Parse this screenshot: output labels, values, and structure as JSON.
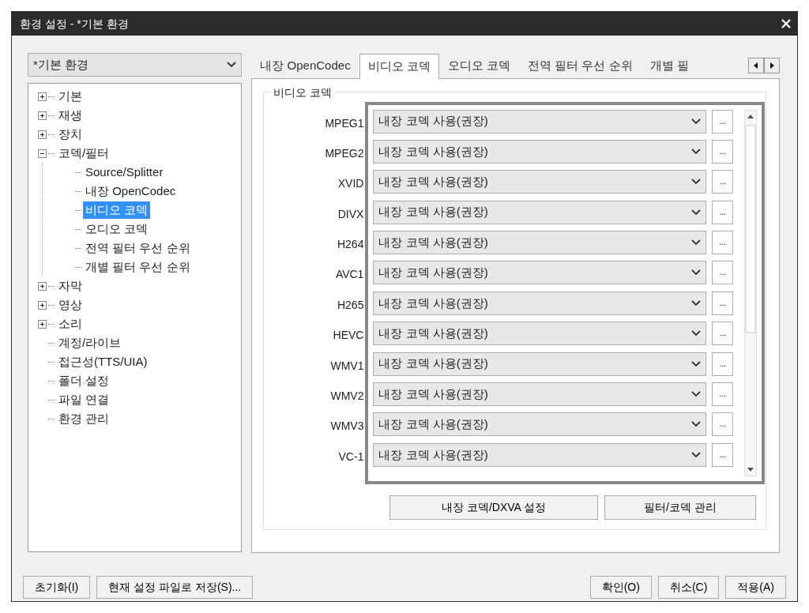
{
  "window": {
    "title": "환경 설정 - *기본 환경"
  },
  "profile": {
    "value": "*기본 환경"
  },
  "tree": [
    {
      "label": "기본",
      "expanded": false,
      "selected": false
    },
    {
      "label": "재생",
      "expanded": false,
      "selected": false
    },
    {
      "label": "장치",
      "expanded": false,
      "selected": false
    },
    {
      "label": "코덱/필터",
      "expanded": true,
      "selected": false,
      "children": [
        {
          "label": "Source/Splitter",
          "selected": false
        },
        {
          "label": "내장 OpenCodec",
          "selected": false
        },
        {
          "label": "비디오 코덱",
          "selected": true
        },
        {
          "label": "오디오 코덱",
          "selected": false
        },
        {
          "label": "전역 필터 우선 순위",
          "selected": false
        },
        {
          "label": "개별 필터 우선 순위",
          "selected": false
        }
      ]
    },
    {
      "label": "자막",
      "expanded": false,
      "selected": false
    },
    {
      "label": "영상",
      "expanded": false,
      "selected": false
    },
    {
      "label": "소리",
      "expanded": false,
      "selected": false
    },
    {
      "label": "계정/라이브",
      "selected": false
    },
    {
      "label": "접근성(TTS/UIA)",
      "selected": false
    },
    {
      "label": "폴더 설정",
      "selected": false
    },
    {
      "label": "파일 연결",
      "selected": false
    },
    {
      "label": "환경 관리",
      "selected": false
    }
  ],
  "tabs": [
    {
      "label": "내장 OpenCodec",
      "selected": false
    },
    {
      "label": "비디오 코덱",
      "selected": true
    },
    {
      "label": "오디오 코덱",
      "selected": false
    },
    {
      "label": "전역 필터 우선 순위",
      "selected": false
    },
    {
      "label": "개별 필",
      "selected": false
    }
  ],
  "group": {
    "title": "비디오 코덱"
  },
  "codecs": [
    {
      "label": "MPEG1",
      "value": "내장 코덱 사용(권장)",
      "more": "..."
    },
    {
      "label": "MPEG2",
      "value": "내장 코덱 사용(권장)",
      "more": "..."
    },
    {
      "label": "XVID",
      "value": "내장 코덱 사용(권장)",
      "more": "..."
    },
    {
      "label": "DIVX",
      "value": "내장 코덱 사용(권장)",
      "more": "..."
    },
    {
      "label": "H264",
      "value": "내장 코덱 사용(권장)",
      "more": "..."
    },
    {
      "label": "AVC1",
      "value": "내장 코덱 사용(권장)",
      "more": "..."
    },
    {
      "label": "H265",
      "value": "내장 코덱 사용(권장)",
      "more": "..."
    },
    {
      "label": "HEVC",
      "value": "내장 코덱 사용(권장)",
      "more": "..."
    },
    {
      "label": "WMV1",
      "value": "내장 코덱 사용(권장)",
      "more": "..."
    },
    {
      "label": "WMV2",
      "value": "내장 코덱 사용(권장)",
      "more": "..."
    },
    {
      "label": "WMV3",
      "value": "내장 코덱 사용(권장)",
      "more": "..."
    },
    {
      "label": "VC-1",
      "value": "내장 코덱 사용(권장)",
      "more": "..."
    }
  ],
  "panel_buttons": [
    "내장 코덱/DXVA 설정",
    "필터/코덱 관리"
  ],
  "footer": {
    "left": [
      "초기화(I)",
      "현재 설정 파일로 저장(S)..."
    ],
    "right": [
      "확인(O)",
      "취소(C)",
      "적용(A)"
    ]
  }
}
